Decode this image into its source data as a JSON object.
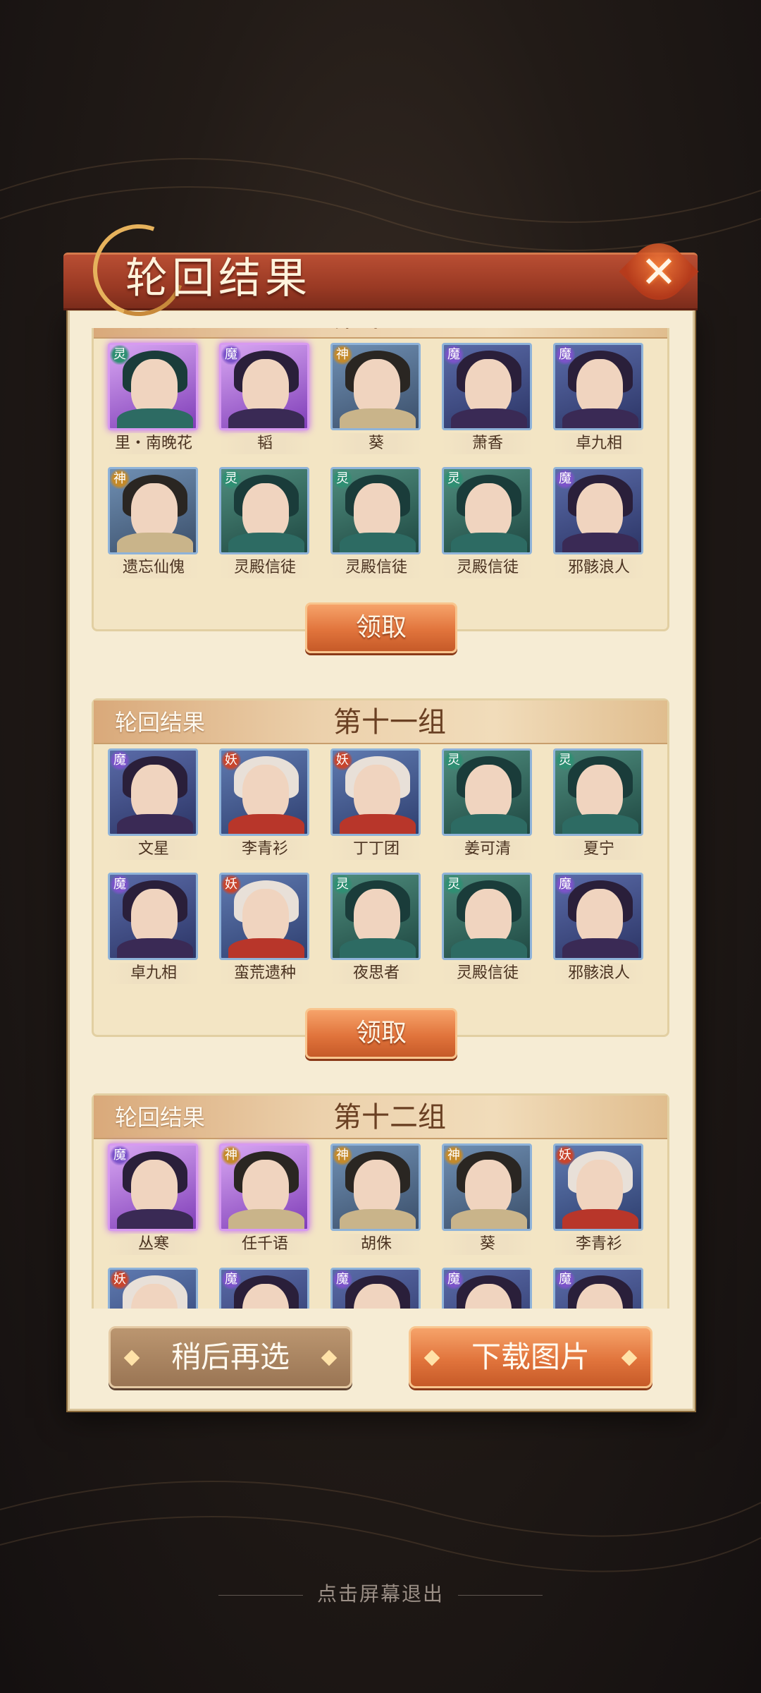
{
  "title": "轮回结果",
  "close_icon": "close-icon",
  "claim_label": "领取",
  "group_label": "轮回结果",
  "colors": {
    "faction_mo": "#7b53c9",
    "faction_ling": "#2f8f73",
    "faction_shen": "#c48a2a",
    "faction_yao": "#c8452d"
  },
  "groups": [
    {
      "name": "第十组",
      "rows": [
        [
          {
            "name": "里・南晚花",
            "faction": "灵",
            "rare": true
          },
          {
            "name": "韬",
            "faction": "魔",
            "rare": true
          },
          {
            "name": "葵",
            "faction": "神",
            "rare": false
          },
          {
            "name": "萧香",
            "faction": "魔",
            "rare": false
          },
          {
            "name": "卓九相",
            "faction": "魔",
            "rare": false
          }
        ],
        [
          {
            "name": "遗忘仙傀",
            "faction": "神",
            "rare": false
          },
          {
            "name": "灵殿信徒",
            "faction": "灵",
            "rare": false
          },
          {
            "name": "灵殿信徒",
            "faction": "灵",
            "rare": false
          },
          {
            "name": "灵殿信徒",
            "faction": "灵",
            "rare": false
          },
          {
            "name": "邪骸浪人",
            "faction": "魔",
            "rare": false
          }
        ]
      ]
    },
    {
      "name": "第十一组",
      "rows": [
        [
          {
            "name": "文星",
            "faction": "魔",
            "rare": false
          },
          {
            "name": "李青衫",
            "faction": "妖",
            "rare": false
          },
          {
            "name": "丁丁团",
            "faction": "妖",
            "rare": false
          },
          {
            "name": "姜可清",
            "faction": "灵",
            "rare": false
          },
          {
            "name": "夏宁",
            "faction": "灵",
            "rare": false
          }
        ],
        [
          {
            "name": "卓九相",
            "faction": "魔",
            "rare": false
          },
          {
            "name": "蛮荒遗种",
            "faction": "妖",
            "rare": false
          },
          {
            "name": "夜思者",
            "faction": "灵",
            "rare": false
          },
          {
            "name": "灵殿信徒",
            "faction": "灵",
            "rare": false
          },
          {
            "name": "邪骸浪人",
            "faction": "魔",
            "rare": false
          }
        ]
      ]
    },
    {
      "name": "第十二组",
      "rows": [
        [
          {
            "name": "丛寒",
            "faction": "魔",
            "rare": true
          },
          {
            "name": "任千语",
            "faction": "神",
            "rare": true
          },
          {
            "name": "胡侏",
            "faction": "神",
            "rare": false
          },
          {
            "name": "葵",
            "faction": "神",
            "rare": false
          },
          {
            "name": "李青衫",
            "faction": "妖",
            "rare": false
          }
        ],
        [
          {
            "name": "",
            "faction": "妖",
            "rare": false
          },
          {
            "name": "",
            "faction": "魔",
            "rare": false
          },
          {
            "name": "",
            "faction": "魔",
            "rare": false
          },
          {
            "name": "",
            "faction": "魔",
            "rare": false
          },
          {
            "name": "",
            "faction": "魔",
            "rare": false
          }
        ]
      ]
    }
  ],
  "buttons": {
    "later": "稍后再选",
    "download": "下载图片"
  },
  "exit_hint": "点击屏幕退出"
}
